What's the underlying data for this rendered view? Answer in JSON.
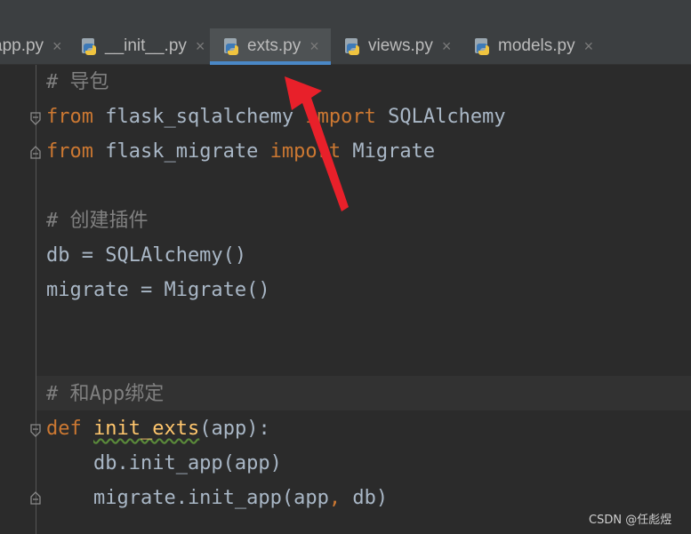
{
  "tabs": [
    {
      "label": "app.py",
      "active": false
    },
    {
      "label": "__init__.py",
      "active": false
    },
    {
      "label": "exts.py",
      "active": true
    },
    {
      "label": "views.py",
      "active": false
    },
    {
      "label": "models.py",
      "active": false
    }
  ],
  "tab_close_glyph": "×",
  "code": {
    "line1": "# 导包",
    "line2_kw1": "from",
    "line2_mod": " flask_sqlalchemy ",
    "line2_kw2": "import",
    "line2_name": " SQLAlchemy",
    "line3_kw1": "from",
    "line3_mod": " flask_migrate ",
    "line3_kw2": "import",
    "line3_name": " Migrate",
    "line5": "# 创建插件",
    "line6": "db = SQLAlchemy()",
    "line7": "migrate = Migrate()",
    "line10": "# 和App绑定",
    "line11_kw": "def",
    "line11_fn": "init_exts",
    "line11_rest": "(app):",
    "line12": "    db.init_app(app)",
    "line13_a": "    migrate.init_app(app",
    "line13_comma": ",",
    "line13_b": " db)"
  },
  "watermark": "CSDN @任彪煜",
  "colors": {
    "background": "#2b2b2b",
    "keyword": "#cc7832",
    "comment": "#808080",
    "function": "#ffc66d",
    "text": "#a9b7c6",
    "active_tab_underline": "#4a88c7",
    "annotation_arrow": "#e8202a"
  }
}
